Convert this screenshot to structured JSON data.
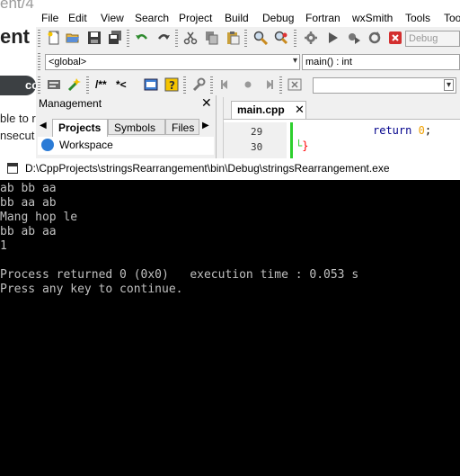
{
  "background_page": {
    "title_fragment": "ent/4",
    "heading_fragment": "ent",
    "pill_fragment": "co",
    "text_line1": "ble to r",
    "text_line2": "nsecut"
  },
  "ide": {
    "menu": [
      "File",
      "Edit",
      "View",
      "Search",
      "Project",
      "Build",
      "Debug",
      "Fortran",
      "wxSmith",
      "Tools",
      "Too"
    ],
    "build_target": "Debug",
    "scope_combo": "<global>",
    "function_combo": "main() : int",
    "doxy_buttons": [
      "/**",
      "*<"
    ],
    "management": {
      "title": "Management",
      "tabs": [
        "Projects",
        "Symbols",
        "Files"
      ],
      "workspace_label": "Workspace"
    },
    "editor": {
      "file_tab": "main.cpp",
      "lines": [
        {
          "number": "29",
          "keyword": "return",
          "value": "0",
          "end": ";"
        },
        {
          "number": "30",
          "brace": "}"
        }
      ]
    }
  },
  "console": {
    "title": "D:\\CppProjects\\stringsRearrangement\\bin\\Debug\\stringsRearrangement.exe",
    "output": "ab bb aa\nbb aa ab\nMang hop le\nbb ab aa\n1\n\nProcess returned 0 (0x0)   execution time : 0.053 s\nPress any key to continue."
  },
  "colors": {
    "keyword": "#00008b",
    "number": "#f0a000",
    "brace": "#ff0000",
    "console_text": "#c0c0c0",
    "console_bg": "#000000"
  }
}
